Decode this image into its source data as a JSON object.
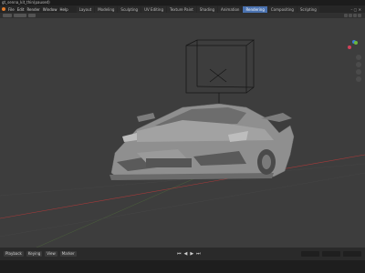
{
  "window": {
    "title": "gt_senna_kit_thin(paused)"
  },
  "menu": {
    "items": [
      "File",
      "Edit",
      "Render",
      "Window",
      "Help"
    ]
  },
  "workspaces": {
    "tabs": [
      "Layout",
      "Modeling",
      "Sculpting",
      "UV Editing",
      "Texture Paint",
      "Shading",
      "Animation",
      "Rendering",
      "Compositing",
      "Scripting"
    ],
    "active_index": 7
  },
  "timeline": {
    "playback_label": "Playback",
    "keying_label": "Keying",
    "view_label": "View",
    "marker_label": "Marker"
  },
  "colors": {
    "accent": "#4a72b0",
    "grid_line_red": "#a83a3a",
    "grid_line_green": "#6aa33a"
  }
}
